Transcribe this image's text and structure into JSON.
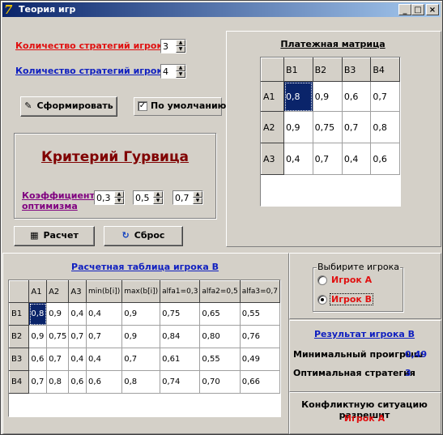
{
  "window": {
    "title": "Теория игр",
    "buttons": [
      "_",
      "□",
      "×"
    ]
  },
  "inputs": {
    "strategies_a_label": "Количество стратегий игрока A",
    "strategies_a_value": "3",
    "strategies_b_label": "Количество стратегий игрока B",
    "strategies_b_value": "4",
    "form_button": "Сформировать",
    "default_checkbox_label": "По умолчанию",
    "default_checked": true
  },
  "criterion": {
    "title": "Критерий Гурвица",
    "coef_label_1": "Коэффициенты",
    "coef_label_2": "оптимизма",
    "coef_values": [
      "0,3",
      "0,5",
      "0,7"
    ]
  },
  "actions": {
    "calc_button": "Расчет",
    "reset_button": "Сброс"
  },
  "payoff": {
    "title": "Платежная матрица",
    "columns": [
      "B1",
      "B2",
      "B3",
      "B4"
    ],
    "rows": [
      {
        "label": "A1",
        "cells": [
          "0,8",
          "0,9",
          "0,6",
          "0,7"
        ]
      },
      {
        "label": "A2",
        "cells": [
          "0,9",
          "0,75",
          "0,7",
          "0,8"
        ]
      },
      {
        "label": "A3",
        "cells": [
          "0,4",
          "0,7",
          "0,4",
          "0,6"
        ]
      }
    ]
  },
  "calc_table": {
    "title": "Расчетная таблица игрока B",
    "columns": [
      "A1",
      "A2",
      "A3",
      "min(b[i])",
      "max(b[i])",
      "alfa1=0,3",
      "alfa2=0,5",
      "alfa3=0,7"
    ],
    "rows": [
      {
        "label": "B1",
        "cells": [
          "0,8",
          "0,9",
          "0,4",
          "0,4",
          "0,9",
          "0,75",
          "0,65",
          "0,55"
        ]
      },
      {
        "label": "B2",
        "cells": [
          "0,9",
          "0,75",
          "0,7",
          "0,7",
          "0,9",
          "0,84",
          "0,80",
          "0,76"
        ]
      },
      {
        "label": "B3",
        "cells": [
          "0,6",
          "0,7",
          "0,4",
          "0,4",
          "0,7",
          "0,61",
          "0,55",
          "0,49"
        ]
      },
      {
        "label": "B4",
        "cells": [
          "0,7",
          "0,8",
          "0,6",
          "0,6",
          "0,8",
          "0,74",
          "0,70",
          "0,66"
        ]
      }
    ]
  },
  "player_select": {
    "group_label": "Выбирите игрока",
    "option_a": "Игрок A",
    "option_b": "Игрок B",
    "selected": "B"
  },
  "result": {
    "title": "Результат игрока B",
    "min_loss_label": "Минимальный проигрыш",
    "min_loss_value": "0,49",
    "strategy_label": "Оптимальная стратегия",
    "strategy_value": "3"
  },
  "conflict": {
    "line1": "Конфликтную ситуацию разрешит",
    "line2": "Игрок A"
  },
  "colors": {
    "title_bar": "#0a246a",
    "red": "#e01010",
    "blue": "#1020c0",
    "criterion_title": "#800000",
    "selection": "#0a246a"
  }
}
